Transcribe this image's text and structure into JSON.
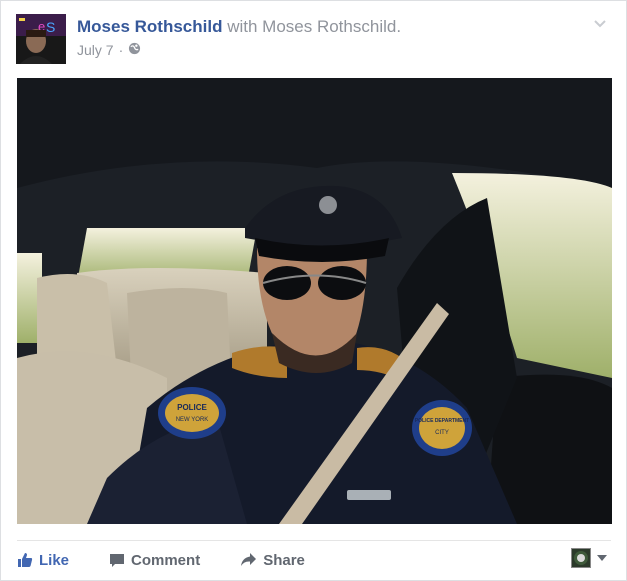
{
  "post": {
    "author": "Moses Rothschild",
    "with_text": "with Moses Rothschild.",
    "date": "July 7",
    "audience_icon": "globe-icon",
    "menu_icon": "chevron-down-icon",
    "photo": {
      "patch_left_text": "POLICE",
      "patch_left_sub": "NEW YORK",
      "patch_right_text": "POLICE DEPARTMENT",
      "patch_right_sub": "CITY"
    }
  },
  "actions": {
    "like_label": "Like",
    "comment_label": "Comment",
    "share_label": "Share"
  },
  "colors": {
    "author": "#365899",
    "like": "#4267b2",
    "muted": "#90949c",
    "action_text": "#616770"
  }
}
